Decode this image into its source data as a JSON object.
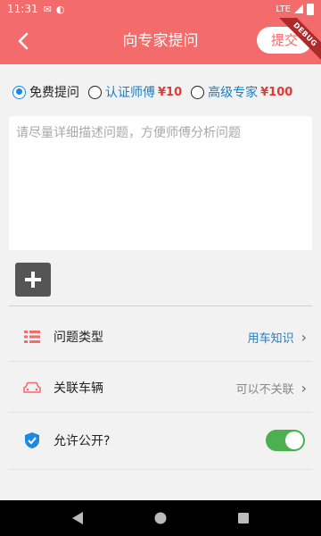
{
  "status_bar": {
    "time": "11:31",
    "network": "LTE"
  },
  "app_bar": {
    "title": "向专家提问",
    "submit_label": "提交",
    "debug_label": "DEBUG"
  },
  "question_types": [
    {
      "label": "免费提问",
      "price": "",
      "selected": true
    },
    {
      "label": "认证师傅",
      "price": "¥10",
      "selected": false
    },
    {
      "label": "高级专家",
      "price": "¥100",
      "selected": false
    }
  ],
  "question_input": {
    "placeholder": "请尽量详细描述问题，方便师傅分析问题"
  },
  "options": {
    "category": {
      "label": "问题类型",
      "value": "用车知识"
    },
    "vehicle": {
      "label": "关联车辆",
      "value": "可以不关联"
    },
    "public": {
      "label": "允许公开?",
      "enabled": true
    }
  },
  "colors": {
    "accent": "#f36b6b",
    "link": "#1a7fc8",
    "price": "#e53935",
    "toggle_on": "#4caf50"
  }
}
